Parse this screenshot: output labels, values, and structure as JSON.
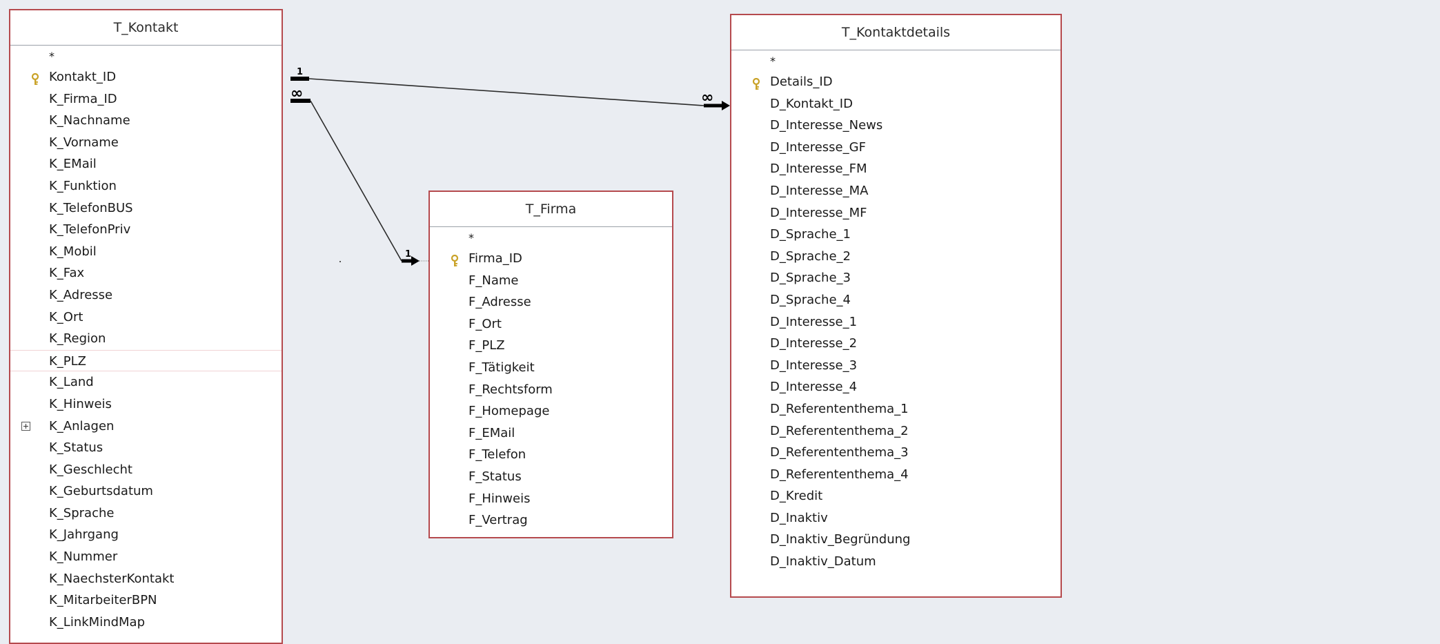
{
  "tables": {
    "kontakt": {
      "title": "T_Kontakt",
      "fields": [
        {
          "name": "*",
          "type": "star"
        },
        {
          "name": "Kontakt_ID",
          "type": "key"
        },
        {
          "name": "K_Firma_ID"
        },
        {
          "name": "K_Nachname"
        },
        {
          "name": "K_Vorname"
        },
        {
          "name": "K_EMail"
        },
        {
          "name": "K_Funktion"
        },
        {
          "name": "K_TelefonBUS"
        },
        {
          "name": "K_TelefonPriv"
        },
        {
          "name": "K_Mobil"
        },
        {
          "name": "K_Fax"
        },
        {
          "name": "K_Adresse"
        },
        {
          "name": "K_Ort"
        },
        {
          "name": "K_Region"
        },
        {
          "name": "K_PLZ",
          "type": "selected"
        },
        {
          "name": "K_Land"
        },
        {
          "name": "K_Hinweis"
        },
        {
          "name": "K_Anlagen",
          "type": "expand"
        },
        {
          "name": "K_Status"
        },
        {
          "name": "K_Geschlecht"
        },
        {
          "name": "K_Geburtsdatum"
        },
        {
          "name": "K_Sprache"
        },
        {
          "name": "K_Jahrgang"
        },
        {
          "name": "K_Nummer"
        },
        {
          "name": "K_NaechsterKontakt"
        },
        {
          "name": "K_MitarbeiterBPN"
        },
        {
          "name": "K_LinkMindMap"
        }
      ]
    },
    "firma": {
      "title": "T_Firma",
      "fields": [
        {
          "name": "*",
          "type": "star"
        },
        {
          "name": "Firma_ID",
          "type": "key"
        },
        {
          "name": "F_Name"
        },
        {
          "name": "F_Adresse"
        },
        {
          "name": "F_Ort"
        },
        {
          "name": "F_PLZ"
        },
        {
          "name": "F_Tätigkeit"
        },
        {
          "name": "F_Rechtsform"
        },
        {
          "name": "F_Homepage"
        },
        {
          "name": "F_EMail"
        },
        {
          "name": "F_Telefon"
        },
        {
          "name": "F_Status"
        },
        {
          "name": "F_Hinweis"
        },
        {
          "name": "F_Vertrag"
        }
      ]
    },
    "kontaktdetails": {
      "title": "T_Kontaktdetails",
      "fields": [
        {
          "name": "*",
          "type": "star"
        },
        {
          "name": "Details_ID",
          "type": "key"
        },
        {
          "name": "D_Kontakt_ID"
        },
        {
          "name": "D_Interesse_News"
        },
        {
          "name": "D_Interesse_GF"
        },
        {
          "name": "D_Interesse_FM"
        },
        {
          "name": "D_Interesse_MA"
        },
        {
          "name": "D_Interesse_MF"
        },
        {
          "name": "D_Sprache_1"
        },
        {
          "name": "D_Sprache_2"
        },
        {
          "name": "D_Sprache_3"
        },
        {
          "name": "D_Sprache_4"
        },
        {
          "name": "D_Interesse_1"
        },
        {
          "name": "D_Interesse_2"
        },
        {
          "name": "D_Interesse_3"
        },
        {
          "name": "D_Interesse_4"
        },
        {
          "name": "D_Referententhema_1"
        },
        {
          "name": "D_Referententhema_2"
        },
        {
          "name": "D_Referententhema_3"
        },
        {
          "name": "D_Referententhema_4"
        },
        {
          "name": "D_Kredit"
        },
        {
          "name": "D_Inaktiv"
        },
        {
          "name": "D_Inaktiv_Begründung"
        },
        {
          "name": "D_Inaktiv_Datum"
        }
      ]
    }
  },
  "relationships": [
    {
      "from": "Kontakt_ID",
      "to": "D_Kontakt_ID",
      "from_label": "1",
      "to_label": "∞"
    },
    {
      "from": "K_Firma_ID",
      "to": "Firma_ID",
      "from_label": "∞",
      "to_label": "1"
    }
  ],
  "colors": {
    "background": "#eaedf2",
    "table_border": "#b5494d",
    "key_icon": "#c9a227"
  }
}
